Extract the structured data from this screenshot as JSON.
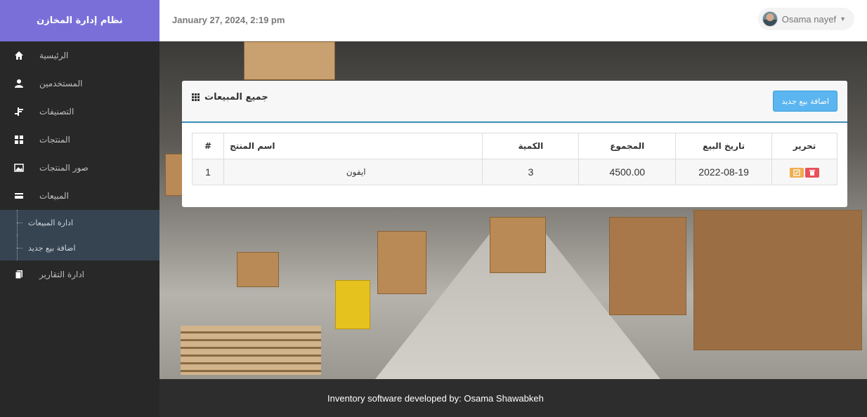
{
  "app": {
    "title": "نظام إدارة المخازن"
  },
  "header": {
    "datetime": "January 27, 2024, 2:19 pm",
    "user_name": "Osama nayef"
  },
  "sidebar": {
    "items": [
      {
        "label": "الرئيسية",
        "icon": "home-icon"
      },
      {
        "label": "المستخدمين",
        "icon": "user-icon"
      },
      {
        "label": "التصنيفات",
        "icon": "categories-icon"
      },
      {
        "label": "المنتجات",
        "icon": "grid-icon"
      },
      {
        "label": "صور المنتجات",
        "icon": "image-icon"
      },
      {
        "label": "المبيعات",
        "icon": "credit-card-icon"
      }
    ],
    "submenu": [
      {
        "label": "ادارة المبيعات"
      },
      {
        "label": "اضافة بيع جديد"
      }
    ],
    "reports": {
      "label": "ادارة التقارير",
      "icon": "files-icon"
    }
  },
  "panel": {
    "title": "جميع المبيعات",
    "add_button": "اضافة بيع جديد",
    "table": {
      "headers": {
        "num": "#",
        "name": "اسم المنتج",
        "qty": "الكمية",
        "total": "المجموع",
        "date": "تاريخ البيع",
        "edit": "تحرير"
      },
      "rows": [
        {
          "num": "1",
          "name": "ايفون",
          "qty": "3",
          "total": "4500.00",
          "date": "2022-08-19"
        }
      ]
    }
  },
  "footer": {
    "text": "Inventory software developed by: Osama Shawabkeh"
  },
  "colors": {
    "brand": "#7a6fd9",
    "sidebar": "#282828",
    "submenu": "#364452",
    "primary_button": "#5bb5f0",
    "edit": "#f0ad4e",
    "delete": "#e9505a"
  }
}
